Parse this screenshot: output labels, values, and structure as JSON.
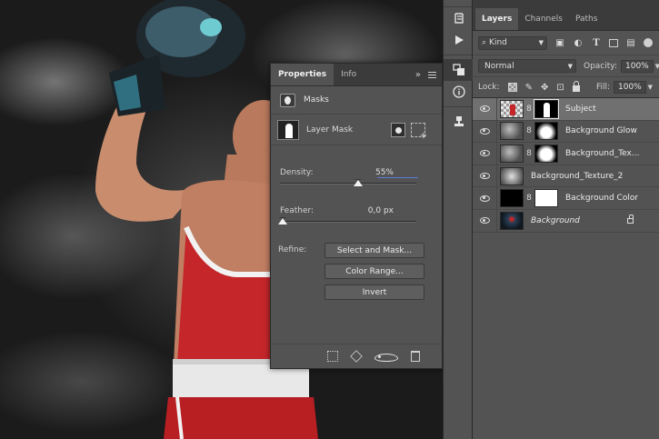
{
  "properties_panel": {
    "tabs": [
      "Properties",
      "Info"
    ],
    "menu_glyph": "»",
    "section_title": "Masks",
    "layer_mask_label": "Layer Mask",
    "density": {
      "label": "Density:",
      "value": "55%",
      "fraction": 0.55
    },
    "feather": {
      "label": "Feather:",
      "value": "0,0 px",
      "fraction": 0.0
    },
    "refine_label": "Refine:",
    "buttons": [
      "Select and Mask...",
      "Color Range...",
      "Invert"
    ]
  },
  "layers_panel": {
    "tabs": [
      "Layers",
      "Channels",
      "Paths"
    ],
    "filter_kind": "Kind",
    "blend_mode": "Normal",
    "opacity_label": "Opacity:",
    "opacity_value": "100%",
    "lock_label": "Lock:",
    "fill_label": "Fill:",
    "fill_value": "100%",
    "layers": [
      {
        "name": "Subject",
        "selected": true,
        "thumb": "checker",
        "mask": "mask-fig",
        "linked": true,
        "italic": false,
        "locked": false
      },
      {
        "name": "Background Glow",
        "selected": false,
        "thumb": "cloud",
        "mask": "mask-glow",
        "linked": true,
        "italic": false,
        "locked": false
      },
      {
        "name": "Background_Tex...",
        "selected": false,
        "thumb": "cloud",
        "mask": "mask-glow2",
        "linked": true,
        "italic": false,
        "locked": false
      },
      {
        "name": "Background_Texture_2",
        "selected": false,
        "thumb": "cloud2",
        "mask": null,
        "linked": false,
        "italic": false,
        "locked": false
      },
      {
        "name": "Background Color",
        "selected": false,
        "thumb": "black",
        "mask": "white",
        "linked": true,
        "italic": false,
        "locked": false
      },
      {
        "name": "Background",
        "selected": false,
        "thumb": "photo",
        "mask": null,
        "linked": false,
        "italic": true,
        "locked": true
      }
    ]
  },
  "tool_strip": {
    "icons": [
      "history-icon",
      "play-icon",
      "layers-comp-icon",
      "info-icon",
      "clone-source-icon"
    ]
  },
  "colors": {
    "panel_bg": "#535353",
    "tab_bg": "#3b3b3b",
    "selected_row": "#707070",
    "density_accent": "#5b7bd6",
    "jersey_red": "#c4262a"
  }
}
